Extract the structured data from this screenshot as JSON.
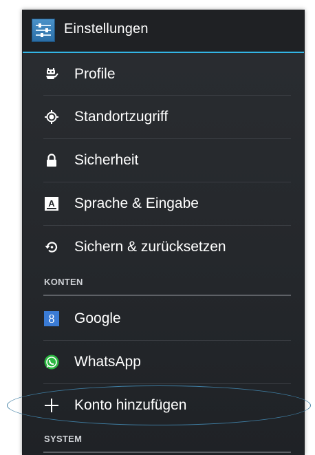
{
  "actionbar": {
    "title": "Einstellungen",
    "icon": "settings-sliders-icon"
  },
  "items": [
    {
      "label": "Profile",
      "icon": "profile-robot-icon"
    },
    {
      "label": "Standortzugriff",
      "icon": "location-icon"
    },
    {
      "label": "Sicherheit",
      "icon": "lock-icon"
    },
    {
      "label": "Sprache & Eingabe",
      "icon": "keyboard-a-icon"
    },
    {
      "label": "Sichern & zurücksetzen",
      "icon": "backup-restore-icon"
    }
  ],
  "sections": {
    "konten": "KONTEN",
    "system": "SYSTEM"
  },
  "accounts": [
    {
      "label": "Google",
      "icon": "google-icon",
      "color": "#3a7bd5"
    },
    {
      "label": "WhatsApp",
      "icon": "whatsapp-icon",
      "color": "#2bb741"
    },
    {
      "label": "Konto hinzufügen",
      "icon": "plus-icon"
    }
  ],
  "colors": {
    "accent": "#33b5e5",
    "annotation": "#3f7ea3"
  }
}
